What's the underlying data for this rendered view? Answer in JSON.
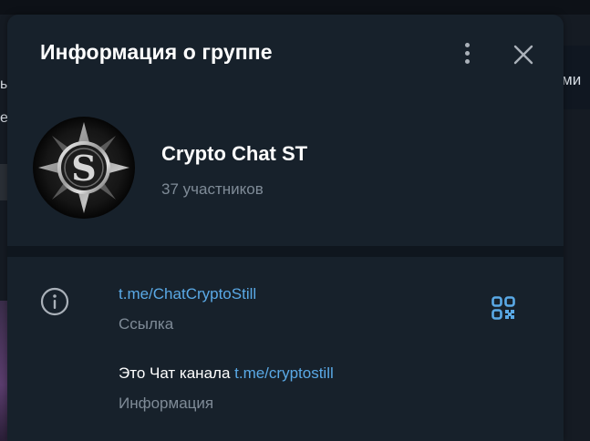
{
  "background": {
    "left_snippet_1": "ы",
    "left_snippet_2": "е",
    "right_snippet": "ми"
  },
  "dialog": {
    "title": "Информация о группе"
  },
  "group": {
    "name": "Crypto Chat ST",
    "members": "37 участников",
    "avatar_letter": "S"
  },
  "link": {
    "value": "t.me/ChatCryptoStill",
    "label": "Ссылка"
  },
  "description": {
    "text": "Это Чат канала ",
    "link": "t.me/cryptostill",
    "label": "Информация"
  },
  "colors": {
    "panel_bg": "#17212b",
    "accent": "#5aa9e6",
    "muted_text": "#7f8b97"
  }
}
